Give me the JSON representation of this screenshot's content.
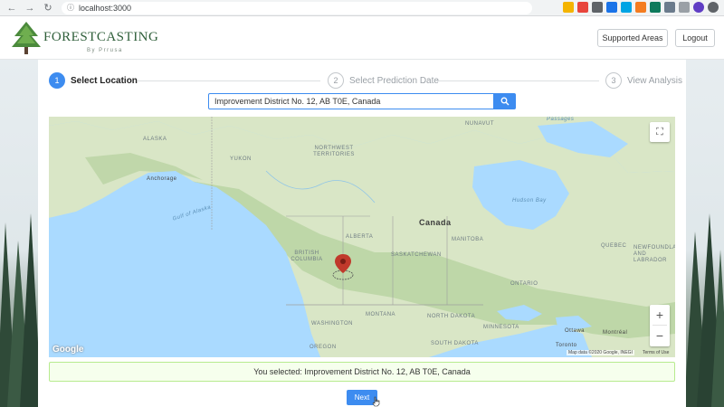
{
  "browser": {
    "url": "localhost:3000"
  },
  "header": {
    "brand": "FORESTCASTING",
    "brand_sub": "By Prrusa",
    "supported_areas_label": "Supported Areas",
    "logout_label": "Logout"
  },
  "stepper": {
    "steps": [
      {
        "number": "1",
        "label": "Select Location",
        "state": "active"
      },
      {
        "number": "2",
        "label": "Select Prediction Date",
        "state": "inactive"
      },
      {
        "number": "3",
        "label": "View Analysis",
        "state": "inactive"
      }
    ]
  },
  "search": {
    "value": "Improvement District No. 12, AB T0E, Canada",
    "icon": "search-icon"
  },
  "map": {
    "labels": {
      "country": "Canada",
      "alaska": "ALASKA",
      "yukon": "YUKON",
      "nunavut": "NUNAVUT",
      "northwest_territories": "NORTHWEST TERRITORIES",
      "british_columbia": "BRITISH COLUMBIA",
      "alberta": "ALBERTA",
      "saskatchewan": "SASKATCHEWAN",
      "manitoba": "MANITOBA",
      "ontario": "ONTARIO",
      "quebec": "QUEBEC",
      "newfoundland": "NEWFOUNDLAND AND LABRADOR",
      "washington": "WASHINGTON",
      "montana": "MONTANA",
      "north_dakota": "NORTH DAKOTA",
      "oregon": "OREGON",
      "south_dakota": "SOUTH DAKOTA",
      "minnesota": "MINNESOTA",
      "anchorage": "Anchorage",
      "gulf_of_alaska": "Gulf of Alaska",
      "hudson_bay": "Hudson Bay",
      "passages": "Passages",
      "ottawa": "Ottawa",
      "toronto": "Toronto",
      "montreal": "Montréal"
    },
    "google": "Google",
    "attribution": "Map data ©2020 Google, INEGI",
    "terms": "Terms of Use",
    "zoom_in": "+",
    "zoom_out": "−",
    "colors": {
      "water": "#aadaff",
      "land": "#d9e6c6",
      "forest": "#b9d3a2",
      "marker": "#c0392b"
    }
  },
  "alert": {
    "text": "You selected: Improvement District No. 12, AB T0E, Canada"
  },
  "next_label": "Next",
  "theme": {
    "accent": "#3d8cf0",
    "success_bg": "#f6ffed",
    "success_border": "#b7eb8f"
  }
}
